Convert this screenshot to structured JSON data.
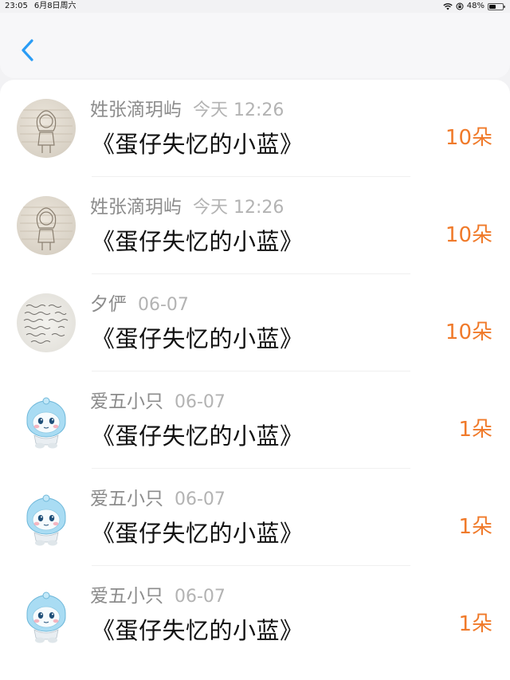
{
  "status_bar": {
    "time": "23:05",
    "date": "6月8日周六",
    "battery": "48%",
    "battery_level": 0.48
  },
  "nav": {
    "back_icon": "chevron-left-icon",
    "accent_color": "#2a9cf5"
  },
  "colors": {
    "amount": "#f07a2a",
    "name": "#8c8c8c",
    "time": "#b3b3b3"
  },
  "rows": [
    {
      "name": "姓张滴玥屿",
      "time": "今天 12:26",
      "title": "《蛋仔失忆的小蓝》",
      "amount": "10朵",
      "avatar": "sketch-avatar"
    },
    {
      "name": "姓张滴玥屿",
      "time": "今天 12:26",
      "title": "《蛋仔失忆的小蓝》",
      "amount": "10朵",
      "avatar": "sketch-avatar"
    },
    {
      "name": "夕俨",
      "time": "06-07",
      "title": "《蛋仔失忆的小蓝》",
      "amount": "10朵",
      "avatar": "note-avatar"
    },
    {
      "name": "爱五小只",
      "time": "06-07",
      "title": "《蛋仔失忆的小蓝》",
      "amount": "1朵",
      "avatar": "mascot-avatar"
    },
    {
      "name": "爱五小只",
      "time": "06-07",
      "title": "《蛋仔失忆的小蓝》",
      "amount": "1朵",
      "avatar": "mascot-avatar"
    },
    {
      "name": "爱五小只",
      "time": "06-07",
      "title": "《蛋仔失忆的小蓝》",
      "amount": "1朵",
      "avatar": "mascot-avatar"
    }
  ]
}
